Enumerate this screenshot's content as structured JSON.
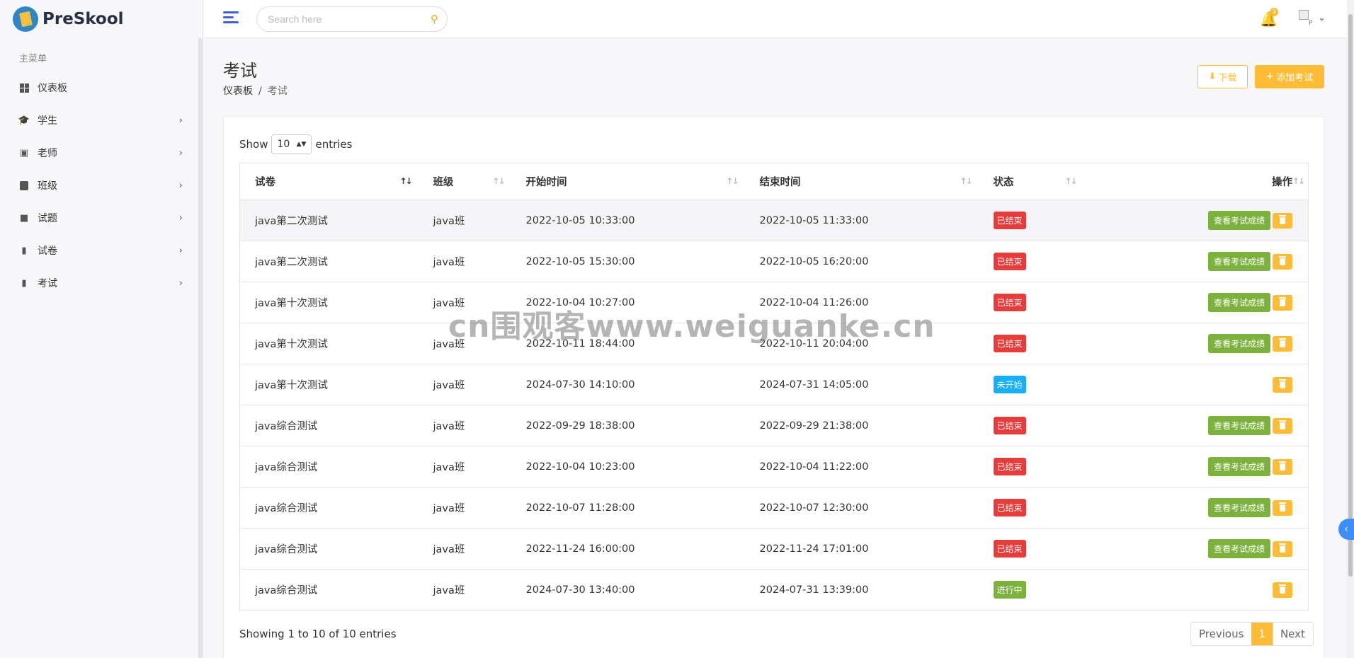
{
  "brand": {
    "name": "PreSkool"
  },
  "sidebar": {
    "menu_title": "主菜单",
    "items": [
      {
        "label": "仪表板",
        "icon": "dashboard-grid-icon",
        "has_children": false
      },
      {
        "label": "学生",
        "icon": "student-cap-icon",
        "has_children": true
      },
      {
        "label": "老师",
        "icon": "teacher-board-icon",
        "has_children": true
      },
      {
        "label": "班级",
        "icon": "building-icon",
        "has_children": true
      },
      {
        "label": "试题",
        "icon": "book-icon",
        "has_children": true
      },
      {
        "label": "试卷",
        "icon": "paper-icon",
        "has_children": true
      },
      {
        "label": "考试",
        "icon": "exam-icon",
        "has_children": true
      }
    ]
  },
  "header": {
    "search_placeholder": "Search here",
    "notification_count": "3",
    "avatar_alt": "P"
  },
  "page": {
    "title": "考试",
    "breadcrumb": [
      "仪表板",
      "考试"
    ],
    "download_label": "下载",
    "add_label": "添加考试"
  },
  "table": {
    "show_label": "Show",
    "entries_label": "entries",
    "page_size": "10",
    "columns": [
      "试卷",
      "班级",
      "开始时间",
      "结束时间",
      "状态",
      "操作"
    ],
    "view_label": "查看考试成绩",
    "rows": [
      {
        "paper": "java第二次测试",
        "class": "java班",
        "start": "2022-10-05 10:33:00",
        "end": "2022-10-05 11:33:00",
        "status": "已结束",
        "status_type": "ended",
        "can_view": true
      },
      {
        "paper": "java第二次测试",
        "class": "java班",
        "start": "2022-10-05 15:30:00",
        "end": "2022-10-05 16:20:00",
        "status": "已结束",
        "status_type": "ended",
        "can_view": true
      },
      {
        "paper": "java第十次测试",
        "class": "java班",
        "start": "2022-10-04 10:27:00",
        "end": "2022-10-04 11:26:00",
        "status": "已结束",
        "status_type": "ended",
        "can_view": true
      },
      {
        "paper": "java第十次测试",
        "class": "java班",
        "start": "2022-10-11 18:44:00",
        "end": "2022-10-11 20:04:00",
        "status": "已结束",
        "status_type": "ended",
        "can_view": true
      },
      {
        "paper": "java第十次测试",
        "class": "java班",
        "start": "2024-07-30 14:10:00",
        "end": "2024-07-31 14:05:00",
        "status": "未开始",
        "status_type": "notstarted",
        "can_view": false
      },
      {
        "paper": "java综合测试",
        "class": "java班",
        "start": "2022-09-29 18:38:00",
        "end": "2022-09-29 21:38:00",
        "status": "已结束",
        "status_type": "ended",
        "can_view": true
      },
      {
        "paper": "java综合测试",
        "class": "java班",
        "start": "2022-10-04 10:23:00",
        "end": "2022-10-04 11:22:00",
        "status": "已结束",
        "status_type": "ended",
        "can_view": true
      },
      {
        "paper": "java综合测试",
        "class": "java班",
        "start": "2022-10-07 11:28:00",
        "end": "2022-10-07 12:30:00",
        "status": "已结束",
        "status_type": "ended",
        "can_view": true
      },
      {
        "paper": "java综合测试",
        "class": "java班",
        "start": "2022-11-24 16:00:00",
        "end": "2022-11-24 17:01:00",
        "status": "已结束",
        "status_type": "ended",
        "can_view": true
      },
      {
        "paper": "java综合测试",
        "class": "java班",
        "start": "2024-07-30 13:40:00",
        "end": "2024-07-31 13:39:00",
        "status": "进行中",
        "status_type": "progress",
        "can_view": false
      }
    ],
    "info": "Showing 1 to 10 of 10 entries",
    "pager": {
      "prev": "Previous",
      "current": "1",
      "next": "Next"
    }
  },
  "watermark": "cn围观客www.weiguanke.cn",
  "colors": {
    "accent": "#ffbc34",
    "primary": "#3d5ee1",
    "success": "#7bb13c",
    "danger": "#e63c3c",
    "info": "#18aefa"
  }
}
